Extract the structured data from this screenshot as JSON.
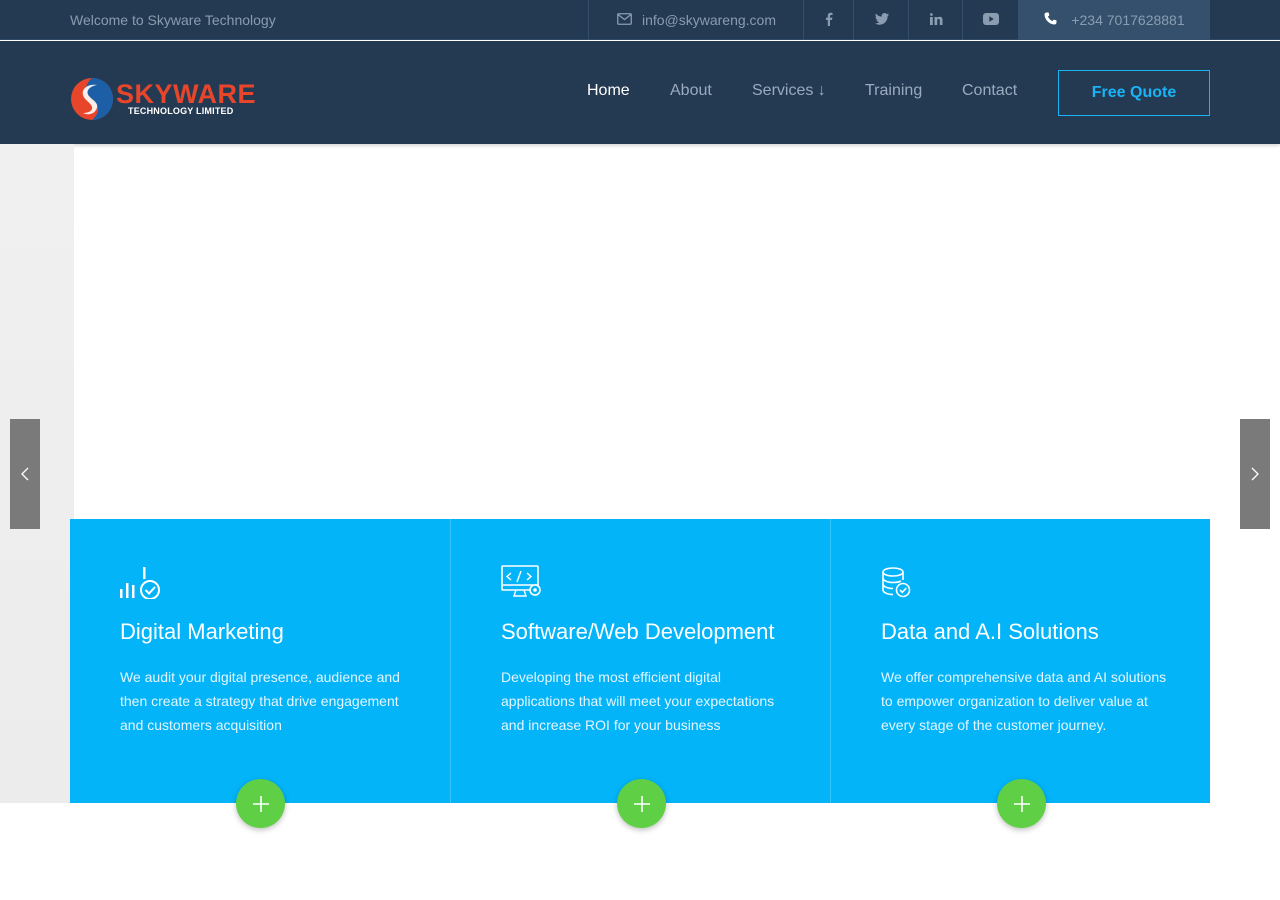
{
  "topbar": {
    "welcome": "Welcome to Skyware Technology",
    "email": "info@skywareng.com",
    "phone": "+234 7017628881",
    "social": [
      "facebook-icon",
      "twitter-icon",
      "linkedin-icon",
      "youtube-icon"
    ]
  },
  "header": {
    "logo_word": "SKYWARE",
    "logo_sub": "TECHNOLOGY LIMITED",
    "nav": {
      "home": "Home",
      "about": "About",
      "services": "Services ↓",
      "training": "Training",
      "contact": "Contact"
    },
    "quote_button": "Free Quote"
  },
  "colors": {
    "dark_navy": "#243a52",
    "accent_blue": "#03b4f9",
    "logo_red": "#e8462b",
    "plus_green": "#5fd045"
  },
  "services": [
    {
      "icon": "analytics-check-icon",
      "title": "Digital Marketing",
      "text": "We audit your digital presence, audience and then create a strategy that drive engagement and customers acquisition"
    },
    {
      "icon": "code-monitor-gear-icon",
      "title": "Software/Web Development",
      "text": "Developing the most efficient digital applications that will meet your expectations and increase ROI for your business"
    },
    {
      "icon": "database-check-icon",
      "title": "Data and A.I Solutions",
      "text": "We offer comprehensive data and AI solutions to empower organization to deliver value at every stage of the customer journey."
    }
  ]
}
